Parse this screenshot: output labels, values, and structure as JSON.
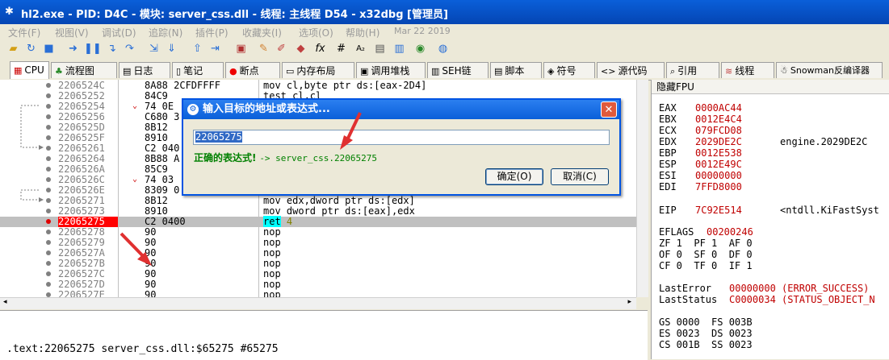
{
  "window": {
    "title": "hl2.exe - PID: D4C - 模块: server_css.dll - 线程: 主线程 D54 - x32dbg [管理员]"
  },
  "menu": [
    "文件(F)",
    "视图(V)",
    "调试(D)",
    "追踪(N)",
    "插件(P)",
    "收藏夹(I)",
    "选项(O)",
    "帮助(H)",
    "Mar 22 2019"
  ],
  "tabs": [
    {
      "label": "CPU",
      "icon": "cpu-icon"
    },
    {
      "label": "流程图",
      "icon": "graph-icon"
    },
    {
      "label": "日志",
      "icon": "log-icon"
    },
    {
      "label": "笔记",
      "icon": "notes-icon"
    },
    {
      "label": "断点",
      "icon": "breakpoint-icon"
    },
    {
      "label": "内存布局",
      "icon": "memory-icon"
    },
    {
      "label": "调用堆栈",
      "icon": "callstack-icon"
    },
    {
      "label": "SEH链",
      "icon": "seh-icon"
    },
    {
      "label": "脚本",
      "icon": "script-icon"
    },
    {
      "label": "符号",
      "icon": "symbol-icon"
    },
    {
      "label": "源代码",
      "icon": "source-icon"
    },
    {
      "label": "引用",
      "icon": "references-icon"
    },
    {
      "label": "线程",
      "icon": "threads-icon"
    },
    {
      "label": "Snowman反编译器",
      "icon": "snowman-icon"
    }
  ],
  "disasm": [
    {
      "addr": "2206524C",
      "bytes": "8A88 2CFDFFFF",
      "instr": "mov cl,byte ptr ds:[eax-2D4]"
    },
    {
      "addr": "22065252",
      "bytes": "84C9",
      "instr": "test cl,cl"
    },
    {
      "addr": "22065254",
      "bytes": "74 0E",
      "instr": ""
    },
    {
      "addr": "22065256",
      "bytes": "C680 3",
      "instr": ""
    },
    {
      "addr": "2206525D",
      "bytes": "8B12",
      "instr": ""
    },
    {
      "addr": "2206525F",
      "bytes": "8910",
      "instr": ""
    },
    {
      "addr": "22065261",
      "bytes": "C2 040",
      "instr": ""
    },
    {
      "addr": "22065264",
      "bytes": "8B88 A",
      "instr": ""
    },
    {
      "addr": "2206526A",
      "bytes": "85C9",
      "instr": ""
    },
    {
      "addr": "2206526C",
      "bytes": "74 03",
      "instr": ""
    },
    {
      "addr": "2206526E",
      "bytes": "8309 0",
      "instr": ""
    },
    {
      "addr": "22065271",
      "bytes": "8B12",
      "instr": "mov edx,dword ptr ds:[edx]"
    },
    {
      "addr": "22065273",
      "bytes": "8910",
      "instr": "mov dword ptr ds:[eax],edx"
    },
    {
      "addr": "22065275",
      "bytes": "C2 0400",
      "instr": "ret 4"
    },
    {
      "addr": "22065278",
      "bytes": "90",
      "instr": "nop"
    },
    {
      "addr": "22065279",
      "bytes": "90",
      "instr": "nop"
    },
    {
      "addr": "2206527A",
      "bytes": "90",
      "instr": "nop"
    },
    {
      "addr": "2206527B",
      "bytes": "90",
      "instr": "nop"
    },
    {
      "addr": "2206527C",
      "bytes": "90",
      "instr": "nop"
    },
    {
      "addr": "2206527D",
      "bytes": "90",
      "instr": "nop"
    },
    {
      "addr": "2206527E",
      "bytes": "90",
      "instr": "nop"
    }
  ],
  "current_row": 13,
  "info_line": ".text:22065275 server_css.dll:$65275 #65275",
  "registers": {
    "header": "隐藏FPU",
    "general": [
      {
        "name": "EAX",
        "value": "0000AC44",
        "comment": ""
      },
      {
        "name": "EBX",
        "value": "0012E4C4",
        "comment": ""
      },
      {
        "name": "ECX",
        "value": "079FCD08",
        "comment": ""
      },
      {
        "name": "EDX",
        "value": "2029DE2C",
        "comment": "engine.2029DE2C"
      },
      {
        "name": "EBP",
        "value": "0012E538",
        "comment": ""
      },
      {
        "name": "ESP",
        "value": "0012E49C",
        "comment": ""
      },
      {
        "name": "ESI",
        "value": "00000000",
        "comment": ""
      },
      {
        "name": "EDI",
        "value": "7FFD8000",
        "comment": ""
      }
    ],
    "eip": {
      "name": "EIP",
      "value": "7C92E514",
      "comment": "<ntdll.KiFastSyst"
    },
    "eflags": {
      "name": "EFLAGS",
      "value": "00200246"
    },
    "flags_rows": [
      "ZF 1  PF 1  AF 0",
      "OF 0  SF 0  DF 0",
      "CF 0  TF 0  IF 1"
    ],
    "last_error": {
      "name": "LastError",
      "value": "00000000 (ERROR_SUCCESS)"
    },
    "last_status": {
      "name": "LastStatus",
      "value": "C0000034 (STATUS_OBJECT_N"
    },
    "segments": [
      "GS 0000  FS 003B",
      "ES 0023  DS 0023",
      "CS 001B  SS 0023"
    ]
  },
  "dialog": {
    "title": "输入目标的地址或表达式...",
    "input_value": "22065275",
    "status_ok": "正确的表达式!",
    "status_result": "-> server_css.22065275",
    "ok_label": "确定(O)",
    "cancel_label": "取消(C)"
  }
}
